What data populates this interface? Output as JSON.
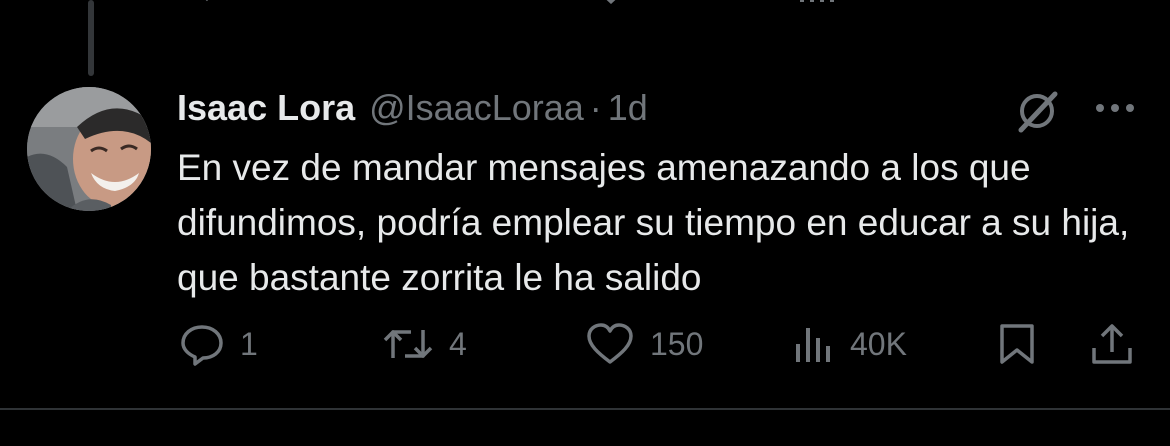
{
  "tweet": {
    "author_name": "Isaac Lora",
    "handle": "@IsaacLoraa",
    "separator": "·",
    "time": "1d",
    "text": "En vez de mandar mensajes amenazando a los que difundimos, podría emplear su tiempo en educar a su hija, que bastante zorrita le ha salido"
  },
  "actions": {
    "replies": "1",
    "reposts": "4",
    "likes": "150",
    "views": "40K"
  },
  "icons": {
    "reply": "speech-bubble-icon",
    "repost": "repost-arrows-icon",
    "like": "heart-icon",
    "views": "bar-chart-icon",
    "bookmark": "bookmark-icon",
    "share": "share-upload-icon",
    "grok": "grok-icon",
    "more": "more-dots-icon"
  },
  "colors": {
    "background": "#000000",
    "primary_text": "#e7e9ea",
    "secondary_text": "#71767b",
    "divider": "#2f3336"
  }
}
